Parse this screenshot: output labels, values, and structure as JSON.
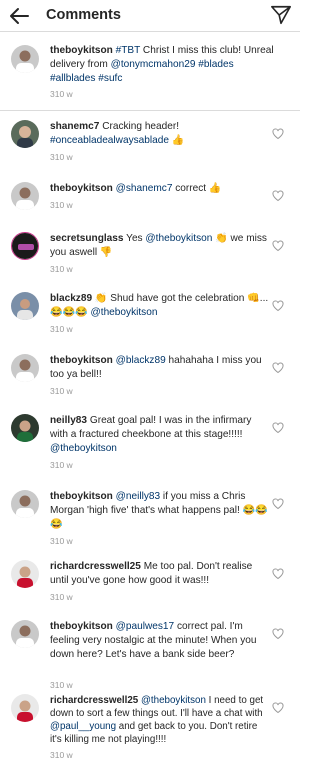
{
  "header": {
    "title": "Comments",
    "back_icon": "back-arrow-icon",
    "send_icon": "direct-send-icon"
  },
  "caption": {
    "user": "theboykitson",
    "text": "#TBT Christ I miss this club! Unreal delivery from @tonymcmahon29 #blades #allblades #sufc",
    "time": "310 w"
  },
  "comments": [
    {
      "user": "shanemc7",
      "text": "Cracking header! #onceabladealwaysablade 👍",
      "time": "310 w"
    },
    {
      "user": "theboykitson",
      "text": "@shanemc7 correct 👍",
      "time": "310 w"
    },
    {
      "user": "secretsunglass",
      "text": "Yes @theboykitson 👏 we miss you aswell 👎",
      "time": "310 w"
    },
    {
      "user": "blackz89",
      "text": "👏 Shud have got the celebration 👊...😂😂😂 @theboykitson",
      "time": "310 w"
    },
    {
      "user": "theboykitson",
      "text": "@blackz89 hahahaha I miss you too ya bell!!",
      "time": "310 w"
    },
    {
      "user": "neilly83",
      "text": "Great goal pal! I was in the infirmary with a fractured cheekbone at this stage!!!!! @theboykitson",
      "time": "310 w"
    },
    {
      "user": "theboykitson",
      "text": "@neilly83 if you miss a Chris Morgan 'high five' that's what happens pal! 😂😂😂",
      "time": "310 w"
    },
    {
      "user": "richardcresswell25",
      "text": "Me too pal. Don't realise until you've gone how good it was!!!",
      "time": "310 w"
    },
    {
      "user": "theboykitson",
      "text": "@paulwes17 correct pal. I'm feeling very nostalgic at the minute! When you down here? Let's have a bank side beer?",
      "time": "310 w"
    },
    {
      "user": "richardcresswell25",
      "text": "@theboykitson I need to get down to sort a few things out. I'll have a chat with @paul__young and get back to you. Don't retire it's killing me not playing!!!!",
      "time": "310 w"
    }
  ],
  "icons": {
    "like": "heart-outline-icon",
    "avatar": "avatar"
  },
  "colors": {
    "link": "#003569",
    "timestamp": "#999999",
    "divider": "#dbdbdb",
    "text": "#262626"
  }
}
